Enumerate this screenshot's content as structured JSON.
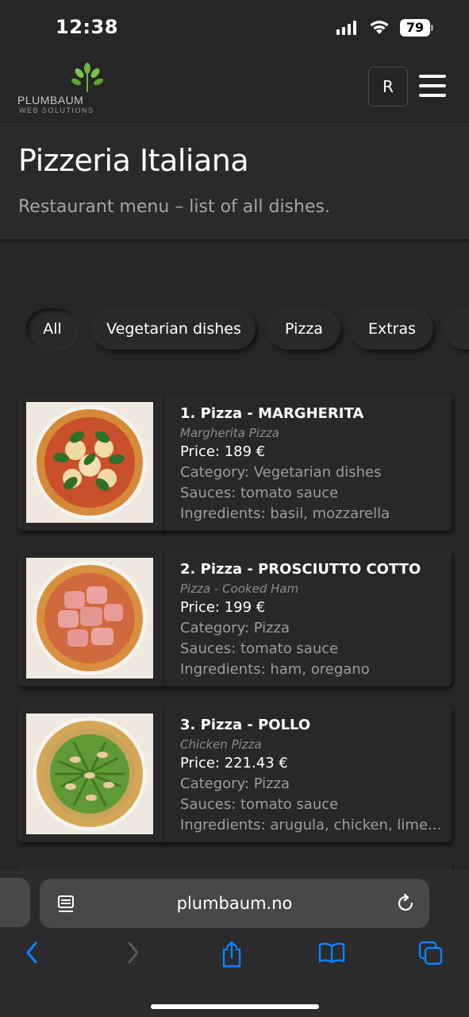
{
  "status_bar": {
    "time": "12:38",
    "battery": "79"
  },
  "header": {
    "logo_name": "PLUMBAUM",
    "logo_sub": "WEB SOLUTIONS",
    "user_initial": "R"
  },
  "hero": {
    "title": "Pizzeria Italiana",
    "subtitle": "Restaurant menu – list of all dishes."
  },
  "filters": [
    {
      "label": "All",
      "active": true
    },
    {
      "label": "Vegetarian dishes",
      "active": false
    },
    {
      "label": "Pizza",
      "active": false
    },
    {
      "label": "Extras",
      "active": false
    }
  ],
  "dishes": [
    {
      "title": "1. Pizza - MARGHERITA",
      "subtitle": "Margherita Pizza",
      "price": "Price: 189 €",
      "category": "Category: Vegetarian dishes",
      "sauces": "Sauces: tomato sauce",
      "ingredients": "Ingredients: basil, mozzarella",
      "image": "margherita-pizza"
    },
    {
      "title": "2. Pizza - PROSCIUTTO COTTO",
      "subtitle": "Pizza - Cooked Ham",
      "price": "Price: 199 €",
      "category": "Category: Pizza",
      "sauces": "Sauces: tomato sauce",
      "ingredients": "Ingredients: ham, oregano",
      "image": "ham-pizza"
    },
    {
      "title": "3. Pizza - POLLO",
      "subtitle": "Chicken Pizza",
      "price": "Price: 221.43 €",
      "category": "Category: Pizza",
      "sauces": "Sauces: tomato sauce",
      "ingredients": "Ingredients: arugula, chicken, lime...",
      "image": "chicken-pizza"
    }
  ],
  "browser": {
    "url": "plumbaum.no",
    "icons": [
      "reader-icon",
      "reload-icon",
      "back-icon",
      "forward-icon",
      "share-icon",
      "bookmarks-icon",
      "tabs-icon"
    ]
  },
  "colors": {
    "background": "#262626",
    "accent_blue": "#0a84ff",
    "logo_green": "#6db33f"
  }
}
